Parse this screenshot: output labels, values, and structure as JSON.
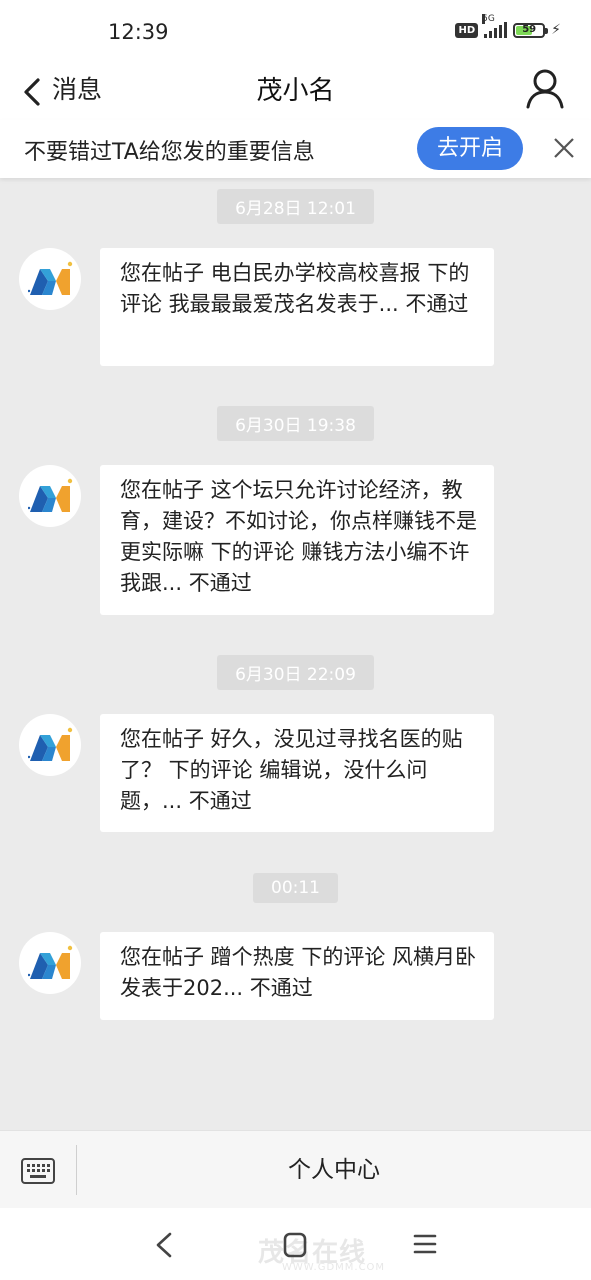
{
  "status_bar": {
    "time": "12:39",
    "hd": "HD",
    "network": "5G",
    "battery": "59"
  },
  "header": {
    "back_label": "消息",
    "title": "茂小名"
  },
  "banner": {
    "text": "不要错过TA给您发的重要信息",
    "button": "去开启"
  },
  "messages": [
    {
      "timestamp": "6月28日 12:01",
      "text": "您在帖子 电白民办学校高校喜报 下的评论 我最最最爱茂名发表于... 不通过"
    },
    {
      "timestamp": "6月30日 19:38",
      "text": "您在帖子 这个坛只允许讨论经济，教育，建设？不如讨论，你点样赚钱不是更实际嘛 下的评论 赚钱方法小编不许我跟... 不通过"
    },
    {
      "timestamp": "6月30日 22:09",
      "text": "您在帖子 好久，没见过寻找名医的贴了？ 下的评论 编辑说，没什么问题，... 不通过"
    },
    {
      "timestamp": "00:11",
      "text": "您在帖子 蹭个热度 下的评论 风横月卧发表于202... 不通过"
    }
  ],
  "bottom_bar": {
    "center_label": "个人中心"
  },
  "watermark": {
    "text": "茂名在线",
    "url": "WWW.GDMM.COM"
  },
  "colors": {
    "accent": "#3d7ce6",
    "battery": "#7ed957"
  }
}
